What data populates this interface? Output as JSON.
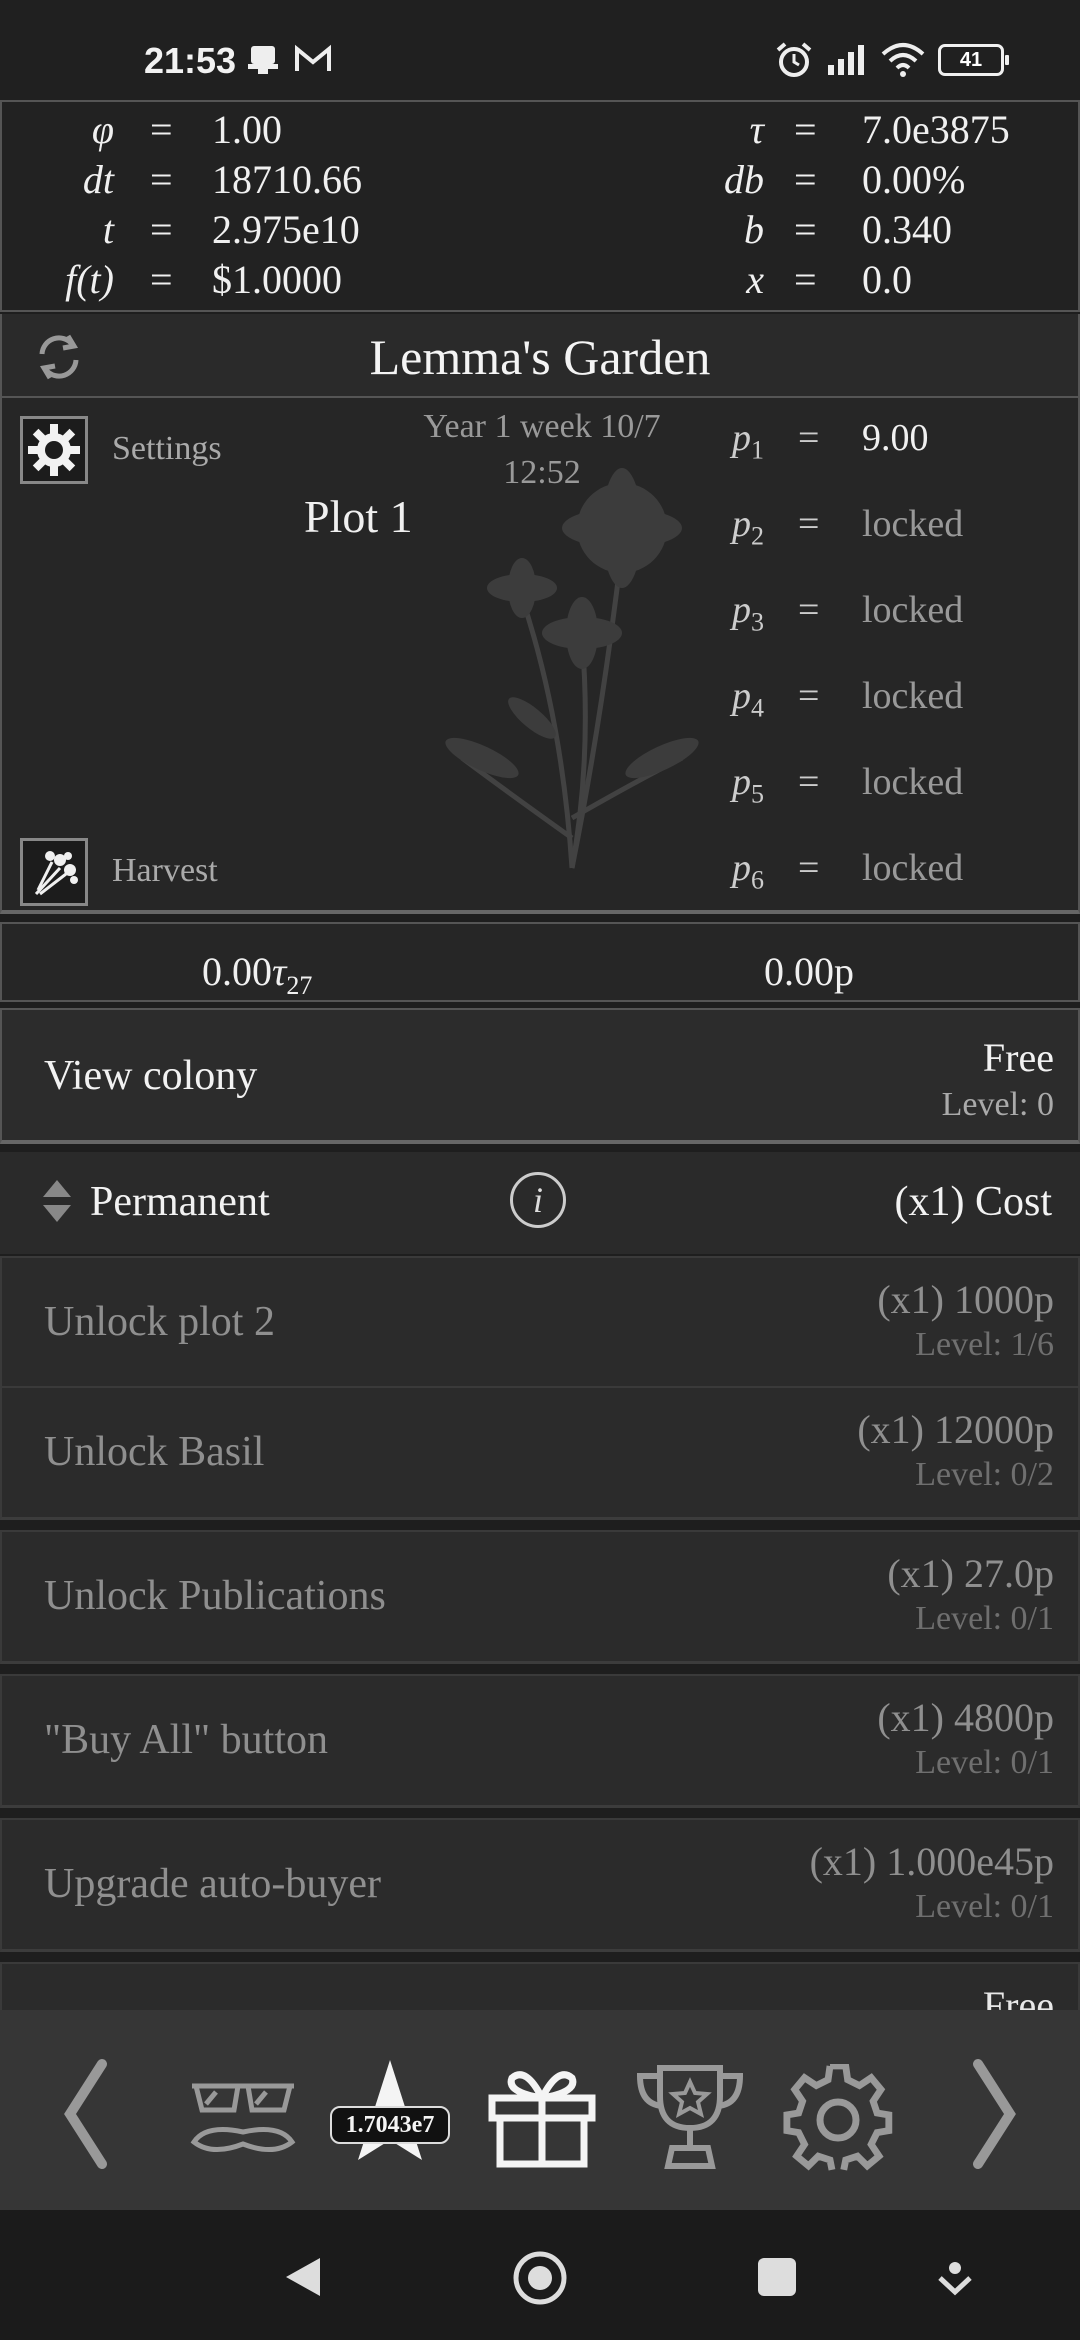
{
  "status_bar": {
    "time": "21:53",
    "battery": "41"
  },
  "variables": [
    {
      "sym": "φ",
      "val": "1.00"
    },
    {
      "sym": "dt",
      "val": "18710.66"
    },
    {
      "sym": "t",
      "val": "2.975e10"
    },
    {
      "sym": "f(t)",
      "val": "$1.0000"
    },
    {
      "sym": "τ",
      "val": "7.0e3875"
    },
    {
      "sym": "db",
      "val": "0.00%"
    },
    {
      "sym": "b",
      "val": "0.340"
    },
    {
      "sym": "x",
      "val": "0.0"
    }
  ],
  "equals": "=",
  "header": {
    "title": "Lemma's Garden"
  },
  "garden": {
    "settings_label": "Settings",
    "harvest_label": "Harvest",
    "date_line": "Year 1 week 10/7",
    "clock": "12:52",
    "plot_title": "Plot 1",
    "plots": [
      {
        "sym": "p",
        "sub": "1",
        "val": "9.00"
      },
      {
        "sym": "p",
        "sub": "2",
        "val": "locked"
      },
      {
        "sym": "p",
        "sub": "3",
        "val": "locked"
      },
      {
        "sym": "p",
        "sub": "4",
        "val": "locked"
      },
      {
        "sym": "p",
        "sub": "5",
        "val": "locked"
      },
      {
        "sym": "p",
        "sub": "6",
        "val": "locked"
      }
    ]
  },
  "currency": {
    "tau_amount": "0.00",
    "tau_symbol": "τ",
    "tau_sub": "27",
    "p_amount": "0.00p"
  },
  "colony": {
    "label": "View colony",
    "price": "Free",
    "level": "Level: 0"
  },
  "permanent": {
    "label": "Permanent",
    "info": "i",
    "cost_header": "(x1) Cost"
  },
  "upgrades": [
    {
      "name": "Unlock plot 2",
      "price": "(x1) 1000p",
      "level": "Level: 1/6"
    },
    {
      "name": "Unlock Basil",
      "price": "(x1) 12000p",
      "level": "Level: 0/2"
    },
    {
      "name": "Unlock Publications",
      "price": "(x1) 27.0p",
      "level": "Level: 0/1"
    },
    {
      "name": "\"Buy All\" button",
      "price": "(x1) 4800p",
      "level": "Level: 0/1"
    },
    {
      "name": "Upgrade auto-buyer",
      "price": "(x1) 1.000e45p",
      "level": "Level: 0/1"
    },
    {
      "name": "",
      "price": "Free",
      "level": ""
    }
  ],
  "bottom_nav": {
    "star_badge": "1.7043e7"
  }
}
